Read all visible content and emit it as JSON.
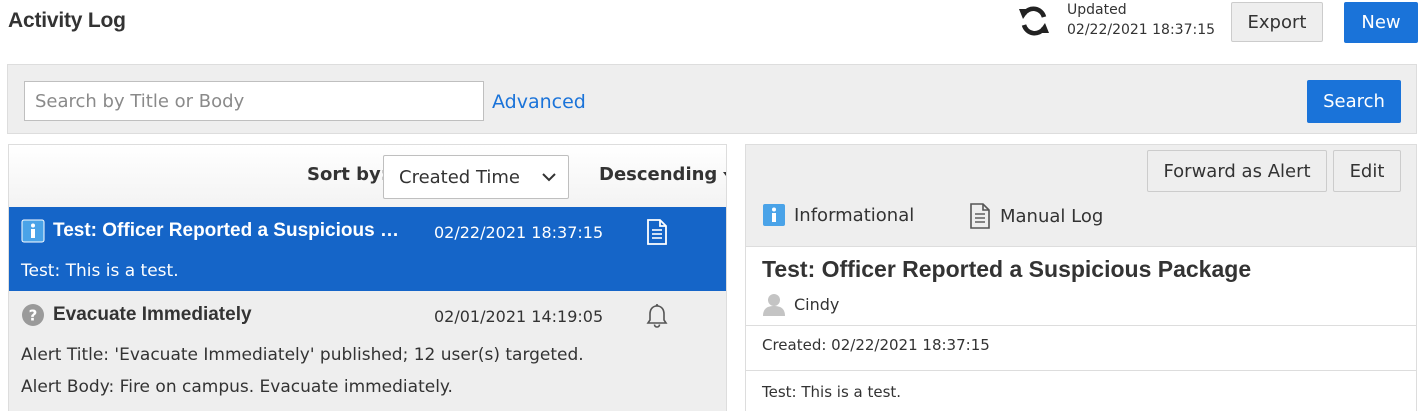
{
  "header": {
    "title": "Activity Log",
    "updated_label": "Updated",
    "updated_time": "02/22/2021 18:37:15",
    "export_label": "Export",
    "new_label": "New"
  },
  "search": {
    "placeholder": "Search by Title or Body",
    "value": "",
    "advanced_label": "Advanced",
    "button_label": "Search"
  },
  "sort": {
    "label": "Sort by:",
    "selected": "Created Time",
    "order": "Descending"
  },
  "list": [
    {
      "icon": "info-icon",
      "title": "Test: Officer Reported a Suspicious Package",
      "date": "02/22/2021 18:37:15",
      "type_icon": "document-icon",
      "body": [
        "Test: This is a test."
      ],
      "selected": true
    },
    {
      "icon": "question-icon",
      "title": "Evacuate Immediately",
      "date": "02/01/2021 14:19:05",
      "type_icon": "bell-icon",
      "body": [
        "Alert Title: 'Evacuate Immediately' published; 12 user(s) targeted.",
        "Alert Body: Fire on campus. Evacuate immediately."
      ],
      "selected": false
    }
  ],
  "detail": {
    "forward_label": "Forward as Alert",
    "edit_label": "Edit",
    "severity": "Informational",
    "source": "Manual Log",
    "title": "Test: Officer Reported a Suspicious Package",
    "author": "Cindy",
    "created": "Created: 02/22/2021 18:37:15",
    "body": "Test: This is a test."
  },
  "colors": {
    "accent": "#1a73d9",
    "selected_row": "#1565c8",
    "panel_bg": "#eeeeee"
  }
}
